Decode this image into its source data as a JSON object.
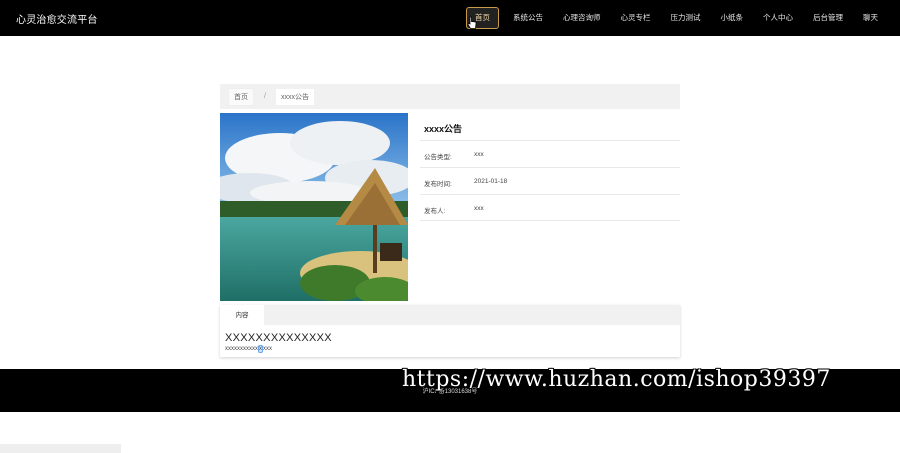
{
  "header": {
    "brand": "心灵治愈交流平台",
    "nav": [
      {
        "label": "首页",
        "active": true
      },
      {
        "label": "系统公告"
      },
      {
        "label": "心理咨询师"
      },
      {
        "label": "心灵专栏"
      },
      {
        "label": "压力测试"
      },
      {
        "label": "小纸条"
      },
      {
        "label": "个人中心"
      },
      {
        "label": "后台管理"
      },
      {
        "label": "聊天"
      }
    ]
  },
  "breadcrumb": {
    "home": "首页",
    "separator": "/",
    "current": "xxxx公告"
  },
  "detail": {
    "title": "xxxx公告",
    "fields": [
      {
        "label": "公告类型:",
        "value": "xxx"
      },
      {
        "label": "发布时间:",
        "value": "2021-01-18"
      },
      {
        "label": "发布人:",
        "value": "xxx"
      }
    ]
  },
  "content": {
    "tab": "内容",
    "heading": "XXXXXXXXXXXXXX",
    "text_before": "xxxxxxxxxxx",
    "text_selected": "x",
    "text_after": "xxx"
  },
  "footer": {
    "icp": "沪ICP备13031638号"
  },
  "watermark": "https://www.huzhan.com/ishop39397",
  "colors": {
    "navbar_bg": "#000000",
    "active_nav_border": "#c89a4a",
    "panel_bg": "#f1f1f1"
  }
}
